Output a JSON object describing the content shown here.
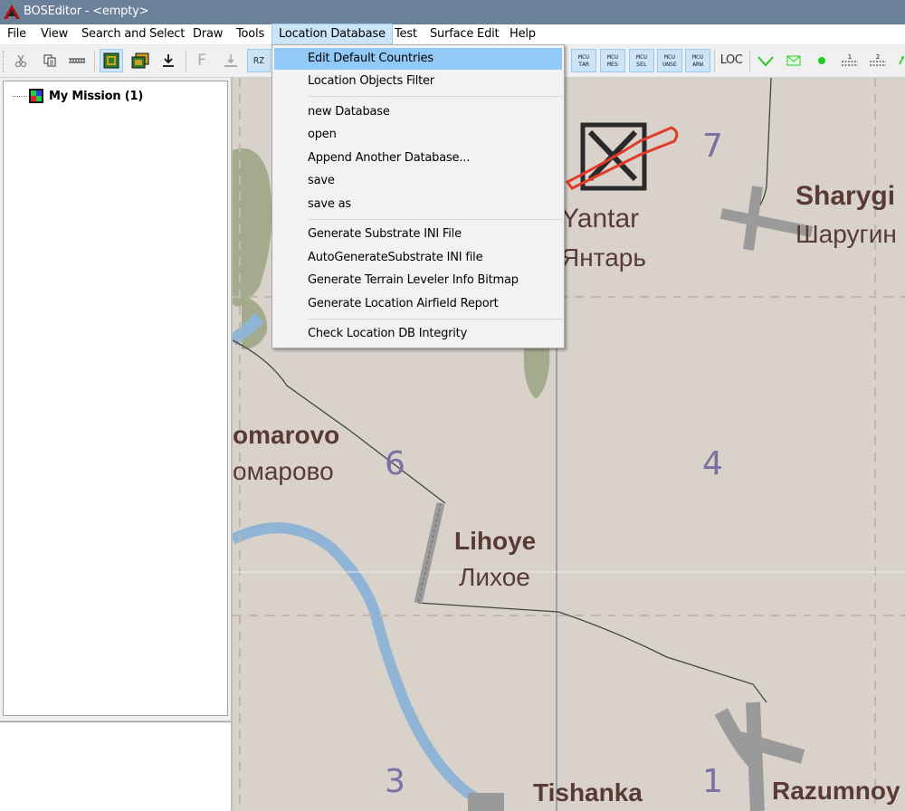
{
  "window": {
    "title": "BOSEditor - <empty>"
  },
  "menubar": {
    "items": [
      "File",
      "View",
      "Search and Select",
      "Draw",
      "Tools",
      "Location Database",
      "Test",
      "Surface Edit",
      "Help"
    ],
    "active": "Location Database"
  },
  "toolbar": {
    "mcu_buttons": [
      {
        "line1": "MCU",
        "line2": "TAR"
      },
      {
        "line1": "MCU",
        "line2": "MES"
      },
      {
        "line1": "MCU",
        "line2": "SEL"
      },
      {
        "line1": "MCU",
        "line2": "UNSE"
      },
      {
        "line1": "MCU",
        "line2": "ARW"
      }
    ],
    "loc_label": "LOC",
    "f_label": "F",
    "rz_label": "RZ",
    "layer1_label": "1",
    "layer2_label": "2"
  },
  "tree": {
    "root_label": "My Mission (1)"
  },
  "dropdown": {
    "items": [
      "Edit Default Countries",
      "Location Objects Filter",
      "new Database",
      "open",
      "Append Another Database...",
      "save",
      "save as",
      "Generate Substrate INI File",
      "AutoGenerateSubstrate INI file",
      "Generate Terrain Leveler Info Bitmap",
      "Generate Location Airfield Report",
      "Check Location DB Integrity"
    ],
    "highlighted": "Edit Default Countries"
  },
  "map": {
    "labels": {
      "yantar": "Yantar",
      "yantar_ru": "Янтарь",
      "sharygin": "Sharygi",
      "sharygin_ru": "Шаругин",
      "komarovo": "omarovo",
      "komarovo_ru": "омарово",
      "lihoye": "Lihoye",
      "lihoye_ru": "Лихое",
      "tishanka": "Tishanka",
      "razumnoye": "Razumnoy"
    },
    "grid_numbers": {
      "n7": "7",
      "n6": "6",
      "n4": "4",
      "n3": "3",
      "n1": "1"
    },
    "colors": {
      "background": "#d8d2cb",
      "river": "#8fb4d6",
      "forest": "#a4ab8d",
      "text": "#5a3a35",
      "grid_number": "#7b6fa3",
      "airfield": "#9a9a9a"
    }
  }
}
